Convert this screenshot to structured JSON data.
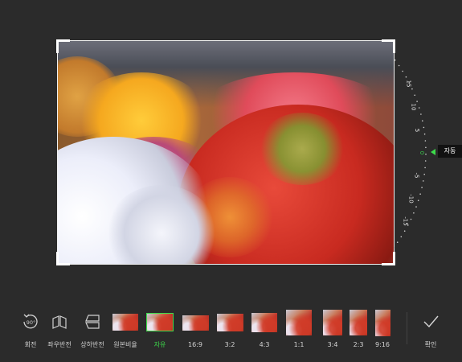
{
  "toolbar": {
    "rotate_label": "회전",
    "rotate_badge": "90°",
    "flip_h_label": "좌우반전",
    "flip_v_label": "상하반전",
    "confirm_label": "확인"
  },
  "ratios": [
    {
      "label": "원본비율",
      "key": "original"
    },
    {
      "label": "자유",
      "key": "free",
      "active": true
    },
    {
      "label": "16:9",
      "key": "16_9"
    },
    {
      "label": "3:2",
      "key": "3_2"
    },
    {
      "label": "4:3",
      "key": "4_3"
    },
    {
      "label": "1:1",
      "key": "1_1"
    },
    {
      "label": "3:4",
      "key": "3_4"
    },
    {
      "label": "2:3",
      "key": "2_3"
    },
    {
      "label": "9:16",
      "key": "9_16"
    }
  ],
  "dial": {
    "labels": [
      "15",
      "10",
      "5",
      "0",
      "-5",
      "-10",
      "-15"
    ],
    "current_value": 0,
    "auto_label": "자동"
  },
  "colors": {
    "accent": "#3ddc4b",
    "background": "#2b2b2b"
  }
}
